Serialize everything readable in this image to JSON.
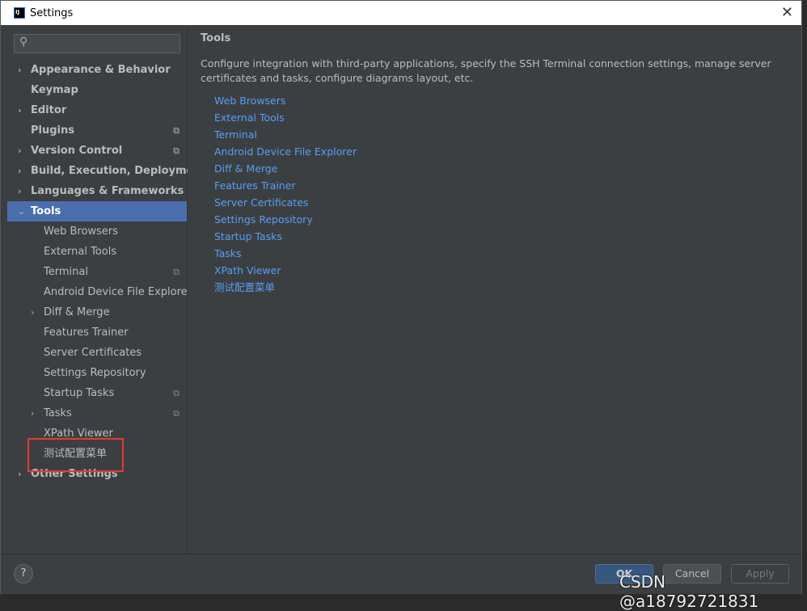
{
  "window": {
    "title": "Settings",
    "close": "✕"
  },
  "sidebar": {
    "items": [
      {
        "label": "Appearance & Behavior",
        "level": 0,
        "arrow": "›",
        "copy": false
      },
      {
        "label": "Keymap",
        "level": 0,
        "arrow": "",
        "copy": false
      },
      {
        "label": "Editor",
        "level": 0,
        "arrow": "›",
        "copy": false
      },
      {
        "label": "Plugins",
        "level": 0,
        "arrow": "",
        "copy": true
      },
      {
        "label": "Version Control",
        "level": 0,
        "arrow": "›",
        "copy": true
      },
      {
        "label": "Build, Execution, Deployment",
        "level": 0,
        "arrow": "›",
        "copy": false
      },
      {
        "label": "Languages & Frameworks",
        "level": 0,
        "arrow": "›",
        "copy": false
      },
      {
        "label": "Tools",
        "level": 0,
        "arrow": "⌄",
        "copy": false,
        "selected": true
      },
      {
        "label": "Web Browsers",
        "level": 1,
        "arrow": "",
        "copy": false
      },
      {
        "label": "External Tools",
        "level": 1,
        "arrow": "",
        "copy": false
      },
      {
        "label": "Terminal",
        "level": 1,
        "arrow": "",
        "copy": true
      },
      {
        "label": "Android Device File Explorer",
        "level": 1,
        "arrow": "",
        "copy": false
      },
      {
        "label": "Diff & Merge",
        "level": 1,
        "arrow": "›",
        "copy": false
      },
      {
        "label": "Features Trainer",
        "level": 1,
        "arrow": "",
        "copy": false
      },
      {
        "label": "Server Certificates",
        "level": 1,
        "arrow": "",
        "copy": false
      },
      {
        "label": "Settings Repository",
        "level": 1,
        "arrow": "",
        "copy": false
      },
      {
        "label": "Startup Tasks",
        "level": 1,
        "arrow": "",
        "copy": true
      },
      {
        "label": "Tasks",
        "level": 1,
        "arrow": "›",
        "copy": true
      },
      {
        "label": "XPath Viewer",
        "level": 1,
        "arrow": "",
        "copy": false
      },
      {
        "label": "测试配置菜单",
        "level": 1,
        "arrow": "",
        "copy": false
      },
      {
        "label": "Other Settings",
        "level": 0,
        "arrow": "›",
        "copy": false
      }
    ]
  },
  "main": {
    "heading": "Tools",
    "description": "Configure integration with third-party applications, specify the SSH Terminal connection settings, manage server certificates and tasks, configure diagrams layout, etc.",
    "links": [
      "Web Browsers",
      "External Tools",
      "Terminal",
      "Android Device File Explorer",
      "Diff & Merge",
      "Features Trainer",
      "Server Certificates",
      "Settings Repository",
      "Startup Tasks",
      "Tasks",
      "XPath Viewer",
      "测试配置菜单"
    ]
  },
  "footer": {
    "help": "?",
    "ok": "OK",
    "cancel": "Cancel",
    "apply": "Apply"
  },
  "watermark": "CSDN @a18792721831",
  "colors": {
    "accent": "#4b6eaf",
    "link": "#589df6",
    "highlight": "#e53935"
  }
}
